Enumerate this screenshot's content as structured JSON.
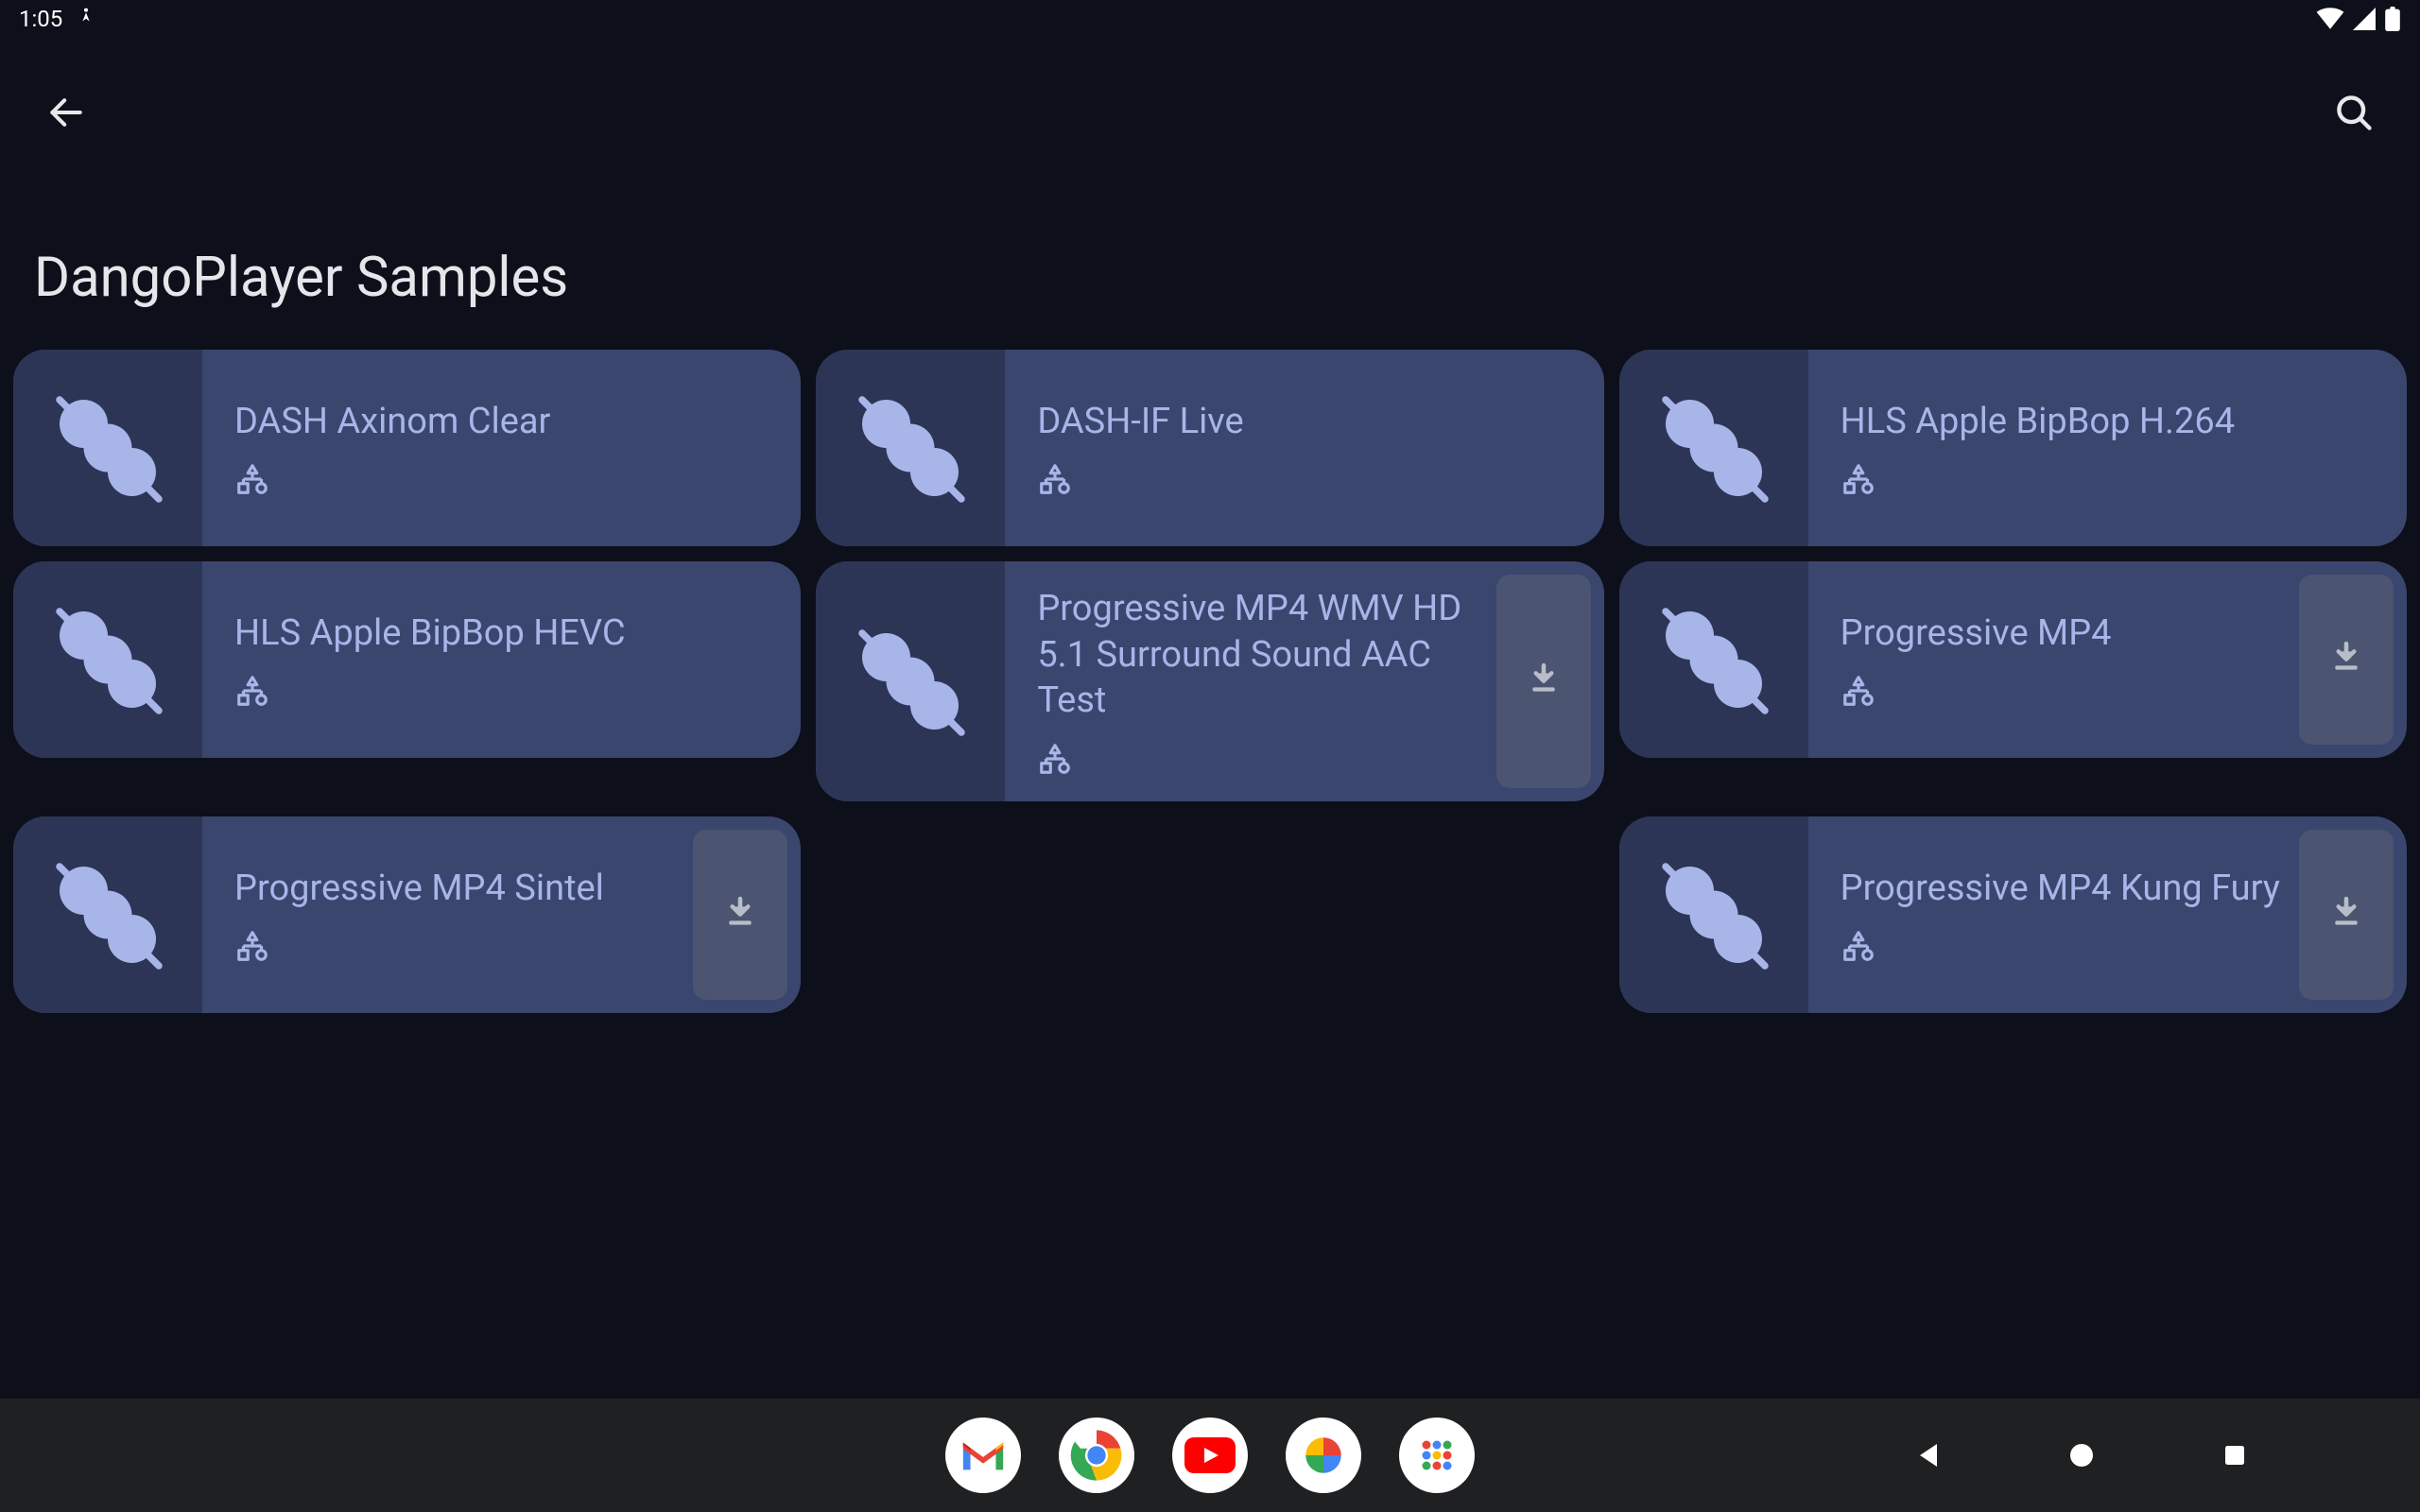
{
  "status": {
    "time": "1:05"
  },
  "header": {
    "title": "DangoPlayer Samples"
  },
  "cards": [
    {
      "title": "DASH Axinom Clear",
      "downloadable": false
    },
    {
      "title": "DASH-IF Live",
      "downloadable": false
    },
    {
      "title": "HLS Apple BipBop H.264",
      "downloadable": false
    },
    {
      "title": "HLS Apple BipBop HEVC",
      "downloadable": false
    },
    {
      "title": "Progressive MP4 WMV HD 5.1 Surround Sound AAC Test",
      "downloadable": true
    },
    {
      "title": "Progressive MP4",
      "downloadable": true
    },
    {
      "title": "Progressive MP4 Sintel",
      "downloadable": true
    },
    {
      "title": "Progressive MP4 Kung Fury",
      "downloadable": true
    }
  ],
  "card_order": [
    0,
    1,
    2,
    3,
    4,
    5,
    6,
    null,
    7
  ]
}
